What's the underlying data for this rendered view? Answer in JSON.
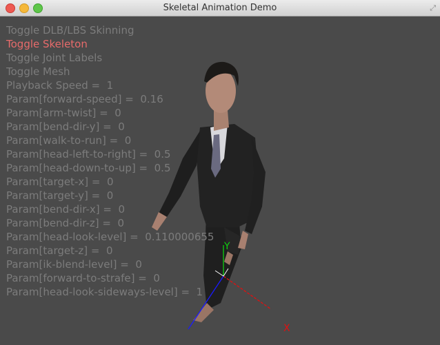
{
  "window": {
    "title": "Skeletal Animation Demo"
  },
  "menu": {
    "items": [
      {
        "label": "Toggle DLB/LBS Skinning"
      },
      {
        "label": "Toggle Skeleton"
      },
      {
        "label": "Toggle Joint Labels"
      },
      {
        "label": "Toggle Mesh"
      },
      {
        "label": "Playback Speed =  1"
      },
      {
        "label": "Param[forward-speed] =  0.16"
      },
      {
        "label": "Param[arm-twist] =  0"
      },
      {
        "label": "Param[bend-dir-y] =  0"
      },
      {
        "label": "Param[walk-to-run] =  0"
      },
      {
        "label": "Param[head-left-to-right] =  0.5"
      },
      {
        "label": "Param[head-down-to-up] =  0.5"
      },
      {
        "label": "Param[target-x] =  0"
      },
      {
        "label": "Param[target-y] =  0"
      },
      {
        "label": "Param[bend-dir-x] =  0"
      },
      {
        "label": "Param[bend-dir-z] =  0"
      },
      {
        "label": "Param[head-look-level] =  0.110000655"
      },
      {
        "label": "Param[target-z] =  0"
      },
      {
        "label": "Param[ik-blend-level] =  0"
      },
      {
        "label": "Param[forward-to-strafe] =  0"
      },
      {
        "label": "Param[head-look-sideways-level] =  1"
      }
    ],
    "active_index": 1
  },
  "axes": {
    "x_label": "X",
    "y_label": "Y"
  },
  "colors": {
    "background": "#4a4a4a",
    "text": "#7c7c7c",
    "active": "#e86b6b",
    "x_axis": "#e01010",
    "y_axis": "#10d010",
    "z_axis": "#1a1aff"
  }
}
